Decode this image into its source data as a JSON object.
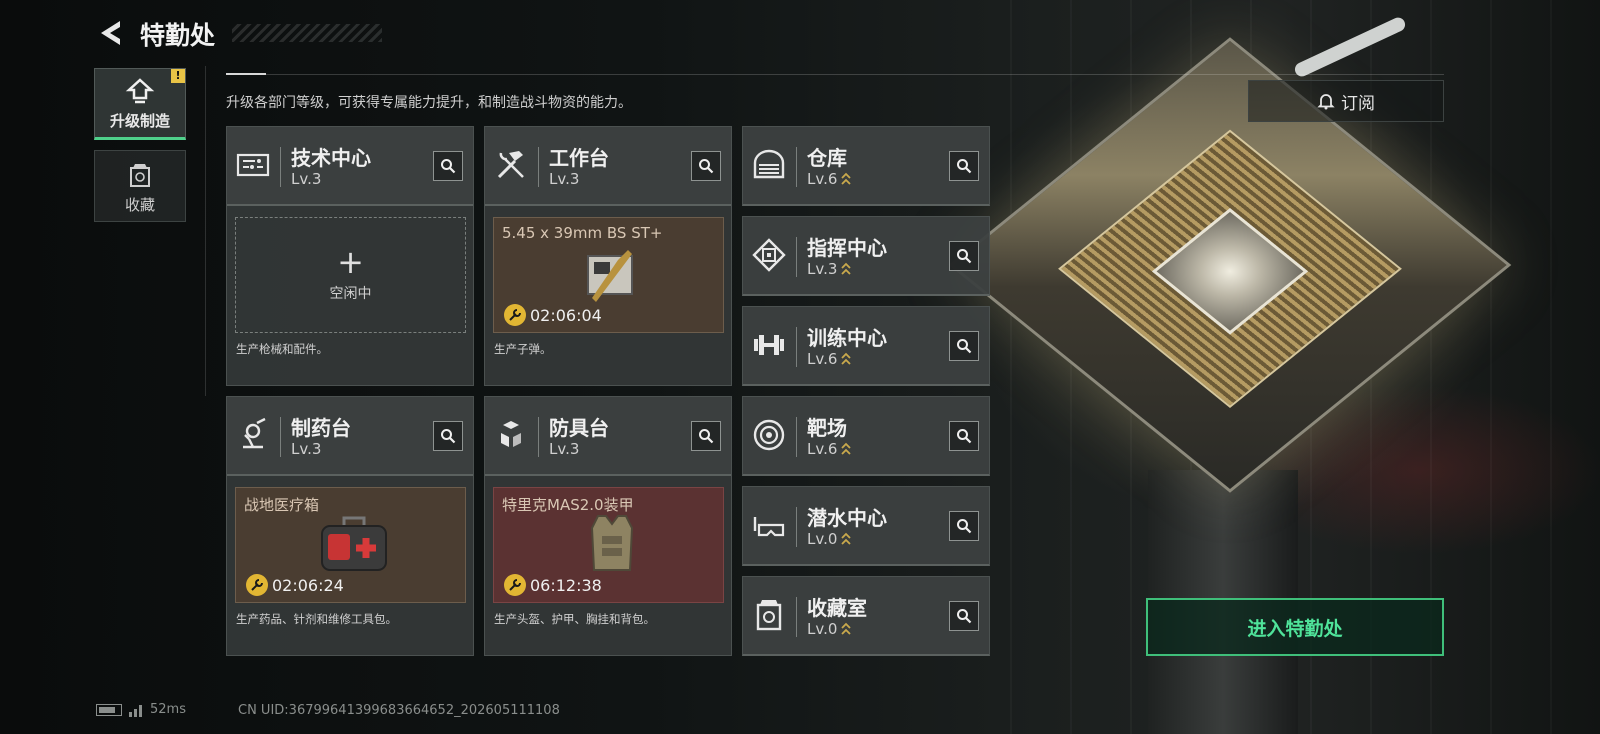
{
  "header": {
    "title": "特勤处"
  },
  "description": "升级各部门等级，可获得专属能力提升，和制造战斗物资的能力。",
  "side_tabs": [
    {
      "label": "升级制造",
      "badge": "!",
      "icon": "upgrade-icon",
      "active": true
    },
    {
      "label": "收藏",
      "icon": "collection-icon",
      "active": false
    }
  ],
  "large_cards": [
    {
      "name": "技术中心",
      "level": "Lv.3",
      "icon": "tech-center-icon",
      "slot_state": "idle",
      "slot_label": "空闲中",
      "description": "生产枪械和配件。"
    },
    {
      "name": "工作台",
      "level": "Lv.3",
      "icon": "workbench-icon",
      "slot_state": "producing",
      "item_name": "5.45 x 39mm BS ST+",
      "timer": "02:06:04",
      "description": "生产子弹。"
    },
    {
      "name": "制药台",
      "level": "Lv.3",
      "icon": "pharmacy-icon",
      "slot_state": "producing",
      "item_name": "战地医疗箱",
      "timer": "02:06:24",
      "description": "生产药品、针剂和维修工具包。"
    },
    {
      "name": "防具台",
      "level": "Lv.3",
      "icon": "armor-bench-icon",
      "slot_state": "producing",
      "item_name": "特里克MAS2.0装甲",
      "timer": "06:12:38",
      "description": "生产头盔、护甲、胸挂和背包。"
    }
  ],
  "small_cards": [
    {
      "name": "仓库",
      "level": "Lv.6",
      "icon": "warehouse-icon"
    },
    {
      "name": "指挥中心",
      "level": "Lv.3",
      "icon": "command-center-icon"
    },
    {
      "name": "训练中心",
      "level": "Lv.6",
      "icon": "training-center-icon"
    },
    {
      "name": "靶场",
      "level": "Lv.6",
      "icon": "shooting-range-icon"
    },
    {
      "name": "潜水中心",
      "level": "Lv.0",
      "icon": "diving-center-icon"
    },
    {
      "name": "收藏室",
      "level": "Lv.0",
      "icon": "collection-room-icon"
    }
  ],
  "subscribe_label": "订阅",
  "enter_button_label": "进入特勤处",
  "status": {
    "ping": "52ms",
    "uid": "CN UID:3679964139968366465​2_202605111108"
  },
  "colors": {
    "accent_green": "#4fe39a",
    "timer_yellow": "#e2b633",
    "upgrade_chevron": "#c9a94c"
  }
}
